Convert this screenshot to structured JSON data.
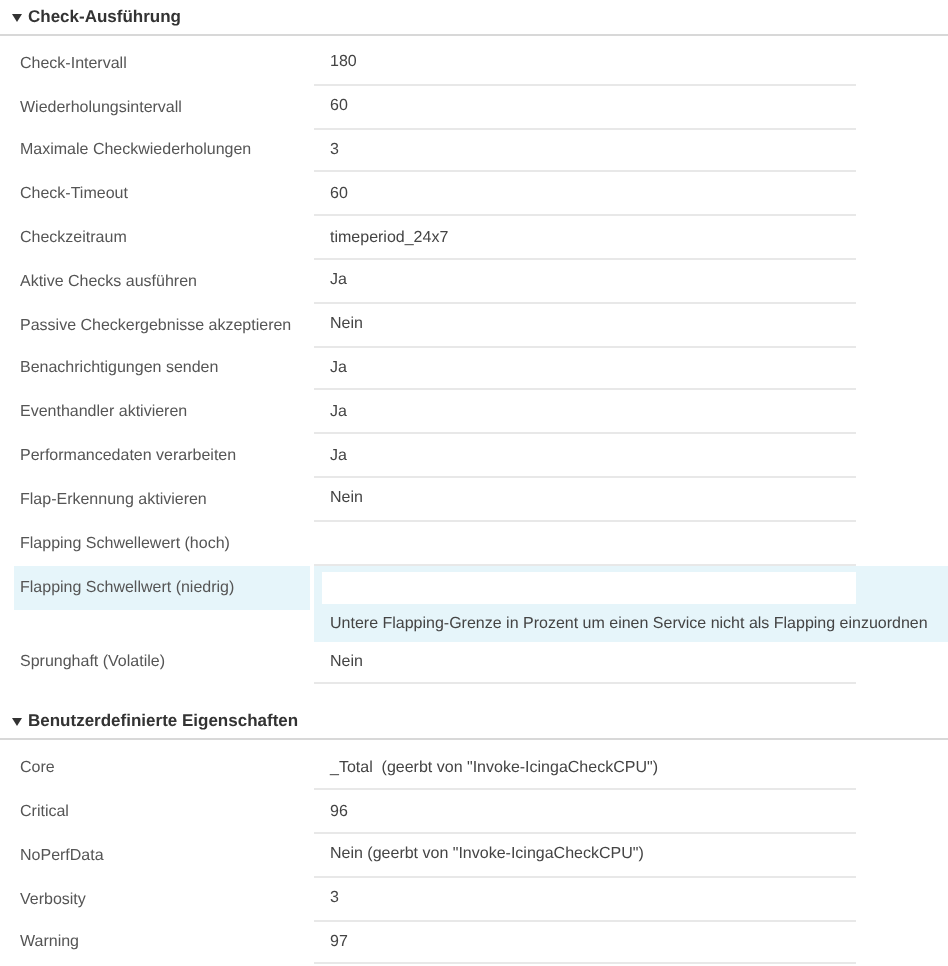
{
  "sections": [
    {
      "title": "Check-Ausführung",
      "expanded": true,
      "rows": [
        {
          "kind": "text",
          "label": "Check-Intervall",
          "value": "180"
        },
        {
          "kind": "text",
          "label": "Wiederholungsintervall",
          "value": "60"
        },
        {
          "kind": "text",
          "label": "Maximale Checkwiederholungen",
          "value": "3"
        },
        {
          "kind": "text",
          "label": "Check-Timeout",
          "value": "60"
        },
        {
          "kind": "text",
          "label": "Checkzeitraum",
          "value": "timeperiod_24x7"
        },
        {
          "kind": "text",
          "label": "Aktive Checks ausführen",
          "value": "Ja"
        },
        {
          "kind": "text",
          "label": "Passive Checkergebnisse akzeptieren",
          "value": "Nein"
        },
        {
          "kind": "text",
          "label": "Benachrichtigungen senden",
          "value": "Ja"
        },
        {
          "kind": "text",
          "label": "Eventhandler aktivieren",
          "value": "Ja"
        },
        {
          "kind": "text",
          "label": "Performancedaten verarbeiten",
          "value": "Ja"
        },
        {
          "kind": "text",
          "label": "Flap-Erkennung aktivieren",
          "value": "Nein"
        },
        {
          "kind": "text",
          "label": "Flapping Schwellewert (hoch)"
        },
        {
          "kind": "field",
          "label": "Flapping Schwellwert (niedrig)",
          "hint": "Untere Flapping-Grenze in Prozent um einen Service nicht als Flapping einzuordnen"
        },
        {
          "kind": "text",
          "label": "Sprunghaft (Volatile)",
          "value": "Nein"
        }
      ]
    },
    {
      "title": "Benutzerdefinierte Eigenschaften",
      "expanded": true,
      "rows": [
        {
          "kind": "text",
          "label": "Core",
          "value": "_Total  (geerbt von \"Invoke-IcingaCheckCPU\")"
        },
        {
          "kind": "text",
          "label": "Critical",
          "value": "96"
        },
        {
          "kind": "text",
          "label": "NoPerfData",
          "value": "Nein (geerbt von \"Invoke-IcingaCheckCPU\")"
        },
        {
          "kind": "text",
          "label": "Verbosity",
          "value": "3"
        },
        {
          "kind": "text",
          "label": "Warning",
          "value": "97"
        }
      ]
    }
  ]
}
